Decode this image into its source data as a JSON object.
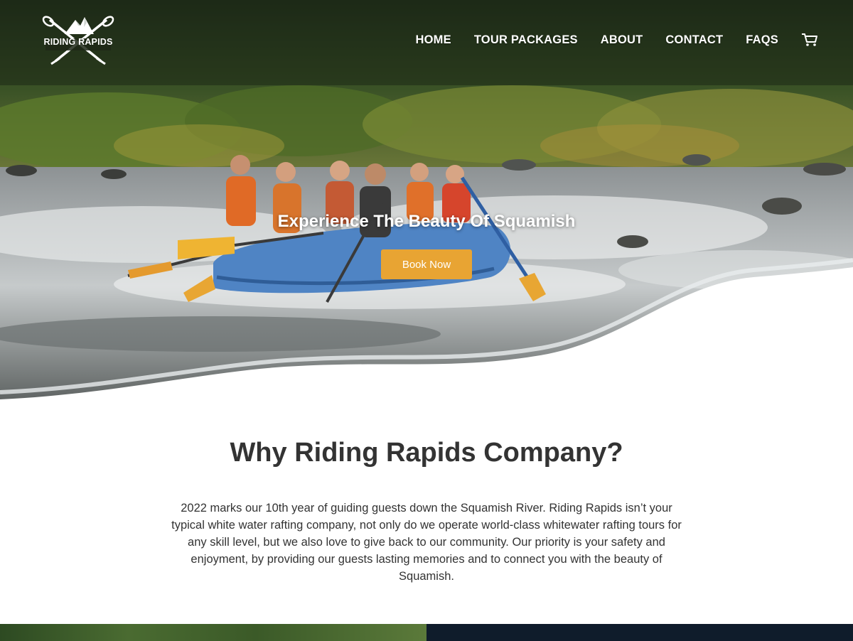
{
  "brand": {
    "logo_text": "RIDING RAPIDS"
  },
  "nav": {
    "items": [
      "HOME",
      "TOUR PACKAGES",
      "ABOUT",
      "CONTACT",
      "FAQS"
    ],
    "cart_icon": "cart-icon"
  },
  "hero": {
    "title": "Experience The Beauty Of Squamish",
    "button_label": "Book Now"
  },
  "why": {
    "title": "Why Riding Rapids Company?",
    "body": "2022 marks our 10th year of guiding guests down the Squamish River. Riding Rapids isn’t your typical white water rafting company, not only do we operate world-class whitewater rafting tours for any skill level, but we also love to give back to our community. Our priority is your safety and enjoyment, by providing our guests lasting memories and to connect you with the beauty of Squamish."
  },
  "colors": {
    "accent": "#e8a433",
    "text": "#333333",
    "footer_dark": "#0f1c2b"
  }
}
